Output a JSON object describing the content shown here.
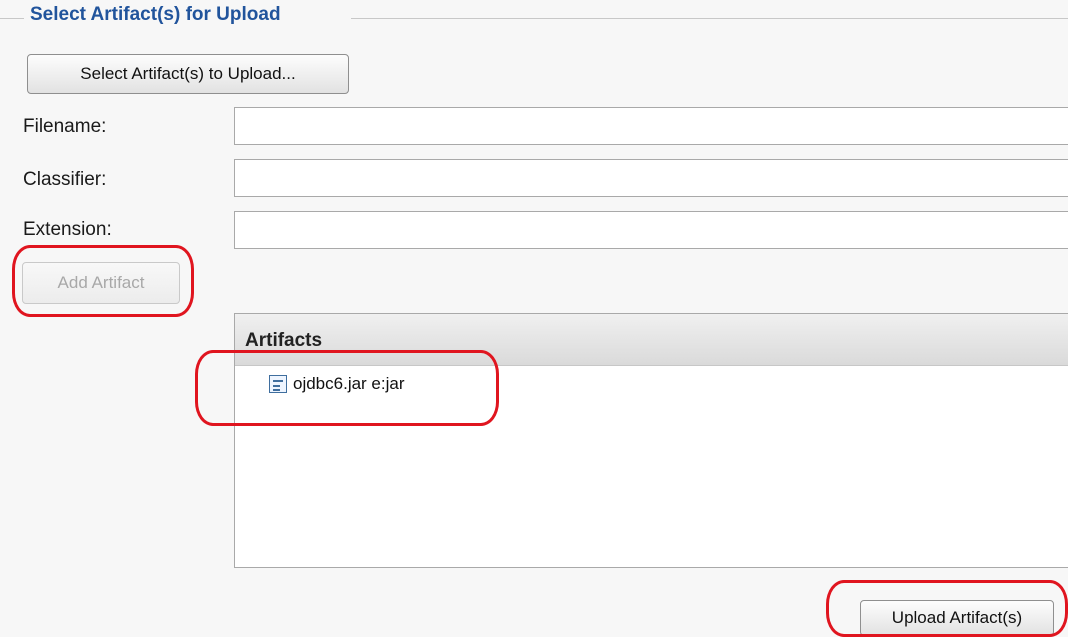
{
  "section": {
    "legend": "Select Artifact(s) for Upload"
  },
  "buttons": {
    "select_artifacts": "Select Artifact(s) to Upload...",
    "add_artifact": "Add Artifact",
    "upload_artifacts": "Upload Artifact(s)"
  },
  "form": {
    "filename_label": "Filename:",
    "filename_value": "",
    "classifier_label": "Classifier:",
    "classifier_value": "",
    "extension_label": "Extension:",
    "extension_value": ""
  },
  "artifacts_panel": {
    "header": "Artifacts",
    "items": [
      {
        "label": "ojdbc6.jar e:jar",
        "icon": "jar-file-icon"
      }
    ]
  },
  "colors": {
    "legend": "#21549c",
    "annotation": "#e0151f",
    "disabled_text": "#a8a8a8"
  }
}
